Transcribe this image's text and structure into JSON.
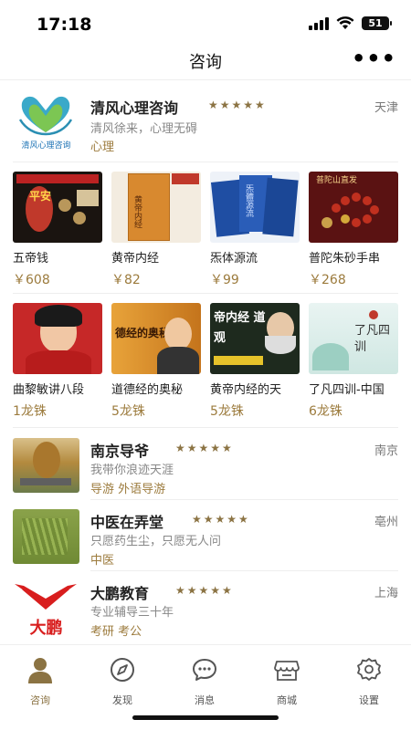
{
  "status": {
    "time": "17:18",
    "battery": "51"
  },
  "nav": {
    "title": "咨询",
    "more_icon": "more-dots-icon"
  },
  "featured": {
    "logo_text": "清风心理咨询",
    "title": "清风心理咨询",
    "stars": "★★★★★",
    "city": "天津",
    "desc": "清风徐来，心理无碍",
    "tags": "心理"
  },
  "products": [
    {
      "name": "五帝钱",
      "price": "￥608",
      "cover_text": "平安"
    },
    {
      "name": "黄帝内经",
      "price": "￥82",
      "cover_text": "黄帝内经"
    },
    {
      "name": "炁体源流",
      "price": "￥99",
      "cover_text": "炁體源流"
    },
    {
      "name": "普陀朱砂手串",
      "price": "￥268",
      "cover_text": "普陀山直发"
    }
  ],
  "courses": [
    {
      "name": "曲黎敏讲八段",
      "price": "1龙铢",
      "cover_text": ""
    },
    {
      "name": "道德经的奥秘",
      "price": "5龙铢",
      "cover_text": "德经的奥秘"
    },
    {
      "name": "黄帝内经的天",
      "price": "5龙铢",
      "cover_text": "帝内经 道观"
    },
    {
      "name": "了凡四训-中国",
      "price": "6龙铢",
      "cover_text": "了凡四训"
    }
  ],
  "consultants": [
    {
      "title": "南京导爷",
      "stars": "★★★★★",
      "city": "南京",
      "desc": "我带你浪迹天涯",
      "tags": "导游 外语导游"
    },
    {
      "title": "中医在弄堂",
      "stars": "★★★★★",
      "city": "亳州",
      "desc": "只愿药生尘，只愿无人问",
      "tags": "中医"
    },
    {
      "title": "大鹏教育",
      "stars": "★★★★★",
      "city": "上海",
      "desc": "专业辅导三十年",
      "tags": "考研 考公",
      "logo_text": "大鹏"
    }
  ],
  "tabs": [
    {
      "label": "咨询",
      "icon": "user-icon",
      "active": true
    },
    {
      "label": "发现",
      "icon": "compass-icon"
    },
    {
      "label": "消息",
      "icon": "chat-icon"
    },
    {
      "label": "商城",
      "icon": "shop-icon"
    },
    {
      "label": "设置",
      "icon": "gear-icon"
    }
  ],
  "colors": {
    "accent": "#9c7b3d",
    "star": "#8b7343"
  }
}
